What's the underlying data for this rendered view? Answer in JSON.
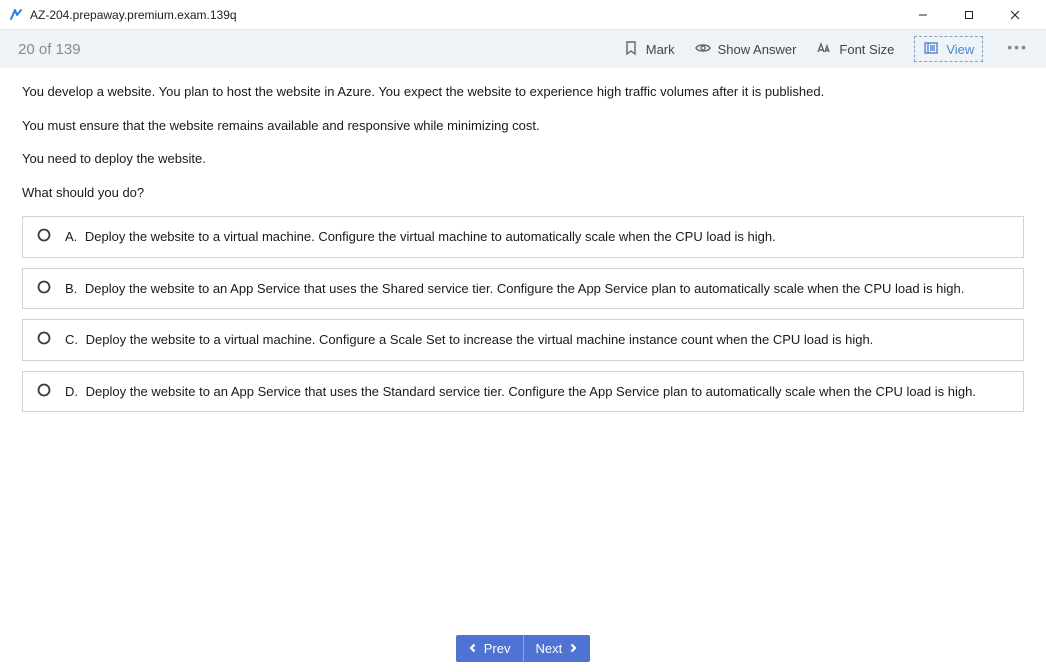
{
  "window": {
    "title": "AZ-204.prepaway.premium.exam.139q"
  },
  "toolbar": {
    "counter": "20 of 139",
    "mark_label": "Mark",
    "show_answer_label": "Show Answer",
    "font_size_label": "Font Size",
    "view_label": "View"
  },
  "question": {
    "paragraphs": [
      "You develop a website. You plan to host the website in Azure. You expect the website to experience high traffic volumes after it is published.",
      "You must ensure that the website remains available and responsive while minimizing cost.",
      "You need to deploy the website.",
      "What should you do?"
    ],
    "answers": [
      {
        "letter": "A.",
        "text": "Deploy the website to a virtual machine. Configure the virtual machine to automatically scale when the CPU load is high."
      },
      {
        "letter": "B.",
        "text": "Deploy the website to an App Service that uses the Shared service tier. Configure the App Service plan to automatically scale when the CPU load is high."
      },
      {
        "letter": "C.",
        "text": "Deploy the website to a virtual machine. Configure a Scale Set to increase the virtual machine instance count when the CPU load is high."
      },
      {
        "letter": "D.",
        "text": "Deploy the website to an App Service that uses the Standard service tier. Configure the App Service plan to automatically scale when the CPU load is high."
      }
    ]
  },
  "footer": {
    "prev_label": "Prev",
    "next_label": "Next"
  }
}
